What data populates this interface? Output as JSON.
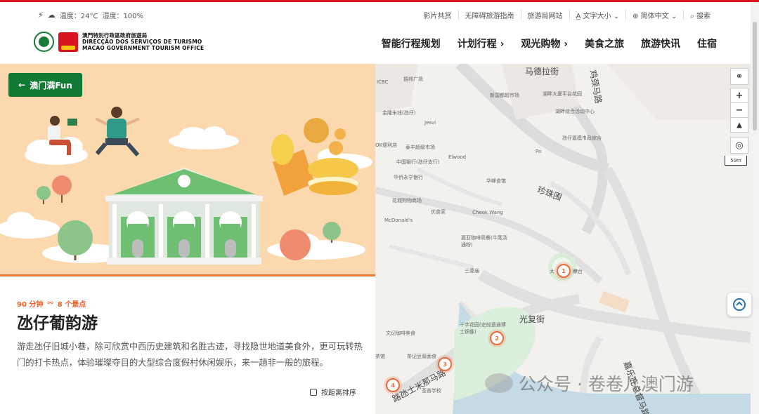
{
  "weather": {
    "temperature": "温度：24°C",
    "humidity": "湿度：100%"
  },
  "utility_links": [
    "影片共赏",
    "无障碍旅游指南",
    "旅游局网站",
    "文字大小",
    "简体中文",
    "搜索"
  ],
  "logo": {
    "line1": "澳門特別行政區政府旅遊局",
    "line2": "DIRECÇÃO DOS SERVIÇOS DE TURISMO",
    "line3": "MACAO GOVERNMENT TOURISM OFFICE"
  },
  "nav": [
    "智能行程规划",
    "计划行程",
    "观光购物",
    "美食之旅",
    "旅游快讯",
    "住宿"
  ],
  "back_button": "澳门满Fun",
  "route": {
    "duration": "90 分钟",
    "spots": "8 个景点",
    "title": "氹仔葡韵游",
    "description": "游走氹仔旧城小巷，除可欣赏中西历史建筑和名胜古迹，寻找隐世地道美食外，更可玩转热门的打卡热点，体验璀璨夺目的大型综合度假村休闲娱乐，来一趟非一般的旅程。",
    "sort_label": "按距离排序"
  },
  "map": {
    "streets": [
      "马德拉街",
      "珍珠围",
      "光复街",
      "鸡颈马路",
      "嘉乐庇总督马路",
      "路氹士米那马路"
    ],
    "places": [
      "ICBC",
      "振邦广场",
      "新国都超市场",
      "湖畔大厦平台花园",
      "湖畔综合活动中心",
      "金隆米线(氹仔)",
      "Jesvi",
      "OK便利店",
      "泰丰超级市场",
      "中国银行(氹仔支行)",
      "Elwood",
      "华侨永亨银行",
      "华峰食馆",
      "Po",
      "氹仔嘉模市政综合",
      "花城购物商场",
      "优食家",
      "Cheok Wang",
      "McDonald's",
      "嘉亚咖啡简餐(牛尾汤通粉)",
      "三婆庙",
      "大",
      "瞭台",
      "十字花园(史前遗通博士铜像)",
      "文记咖啡美食",
      "茶记豆腐面食",
      "茶馆",
      "圣善学校"
    ],
    "scale": "50m",
    "pins": [
      "1",
      "2",
      "3",
      "4"
    ]
  },
  "watermark": "公众号 · 卷卷儿澳门游"
}
